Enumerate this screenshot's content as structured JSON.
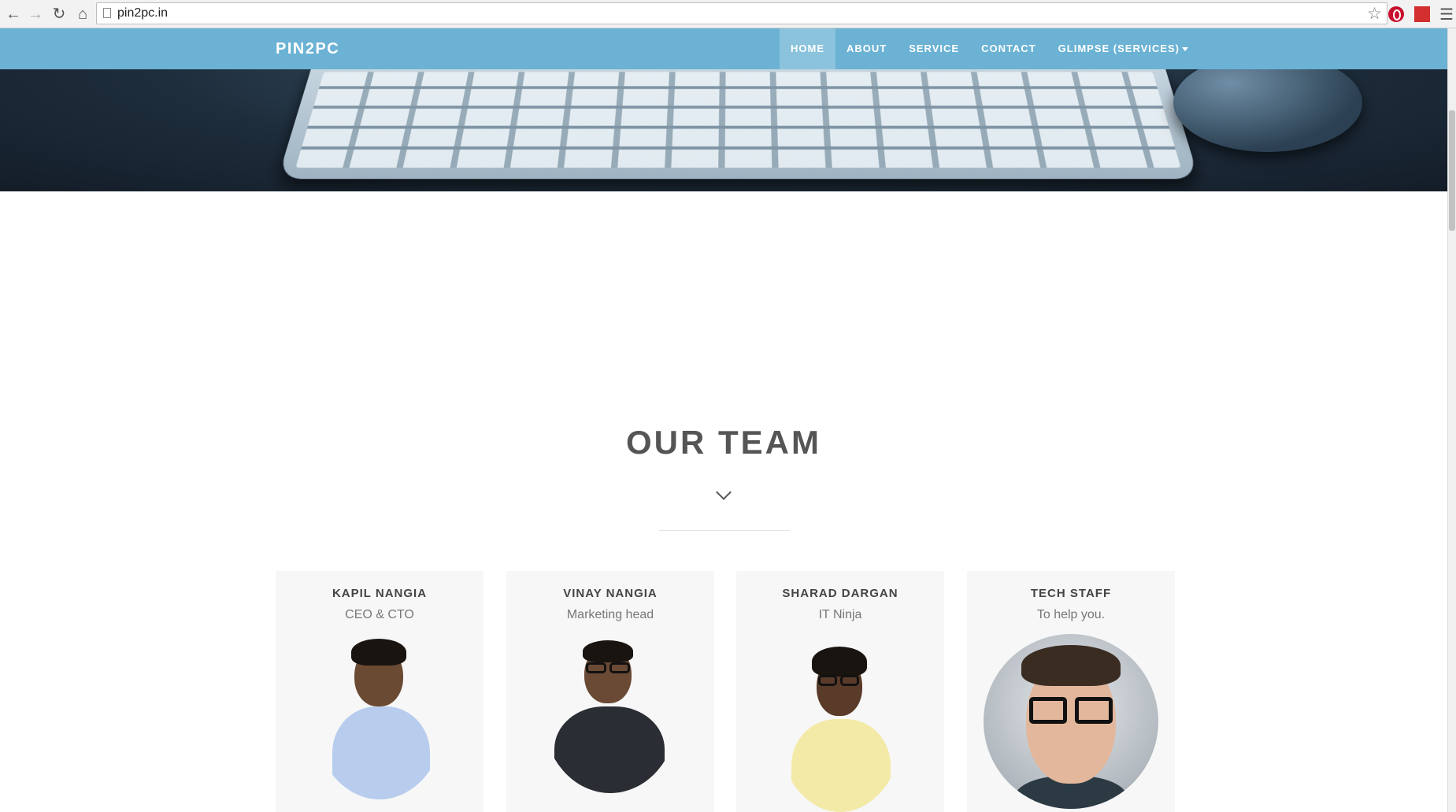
{
  "browser": {
    "url": "pin2pc.in",
    "back_icon": "arrow-left-icon",
    "forward_icon": "arrow-right-icon",
    "reload_icon": "reload-icon",
    "home_icon": "home-icon"
  },
  "navbar": {
    "brand": "PIN2PC",
    "links": [
      {
        "label": "HOME",
        "active": true
      },
      {
        "label": "ABOUT"
      },
      {
        "label": "SERVICE"
      },
      {
        "label": "CONTACT"
      },
      {
        "label": "GLIMPSE (SERVICES)"
      }
    ],
    "bg_color": "#6bb2d4"
  },
  "team": {
    "title": "OUR TEAM",
    "members": [
      {
        "name": "KAPIL NANGIA",
        "role": "CEO & CTO"
      },
      {
        "name": "VINAY NANGIA",
        "role": "Marketing head"
      },
      {
        "name": "SHARAD DARGAN",
        "role": "IT Ninja"
      },
      {
        "name": "TECH STAFF",
        "role": "To help you."
      }
    ]
  }
}
